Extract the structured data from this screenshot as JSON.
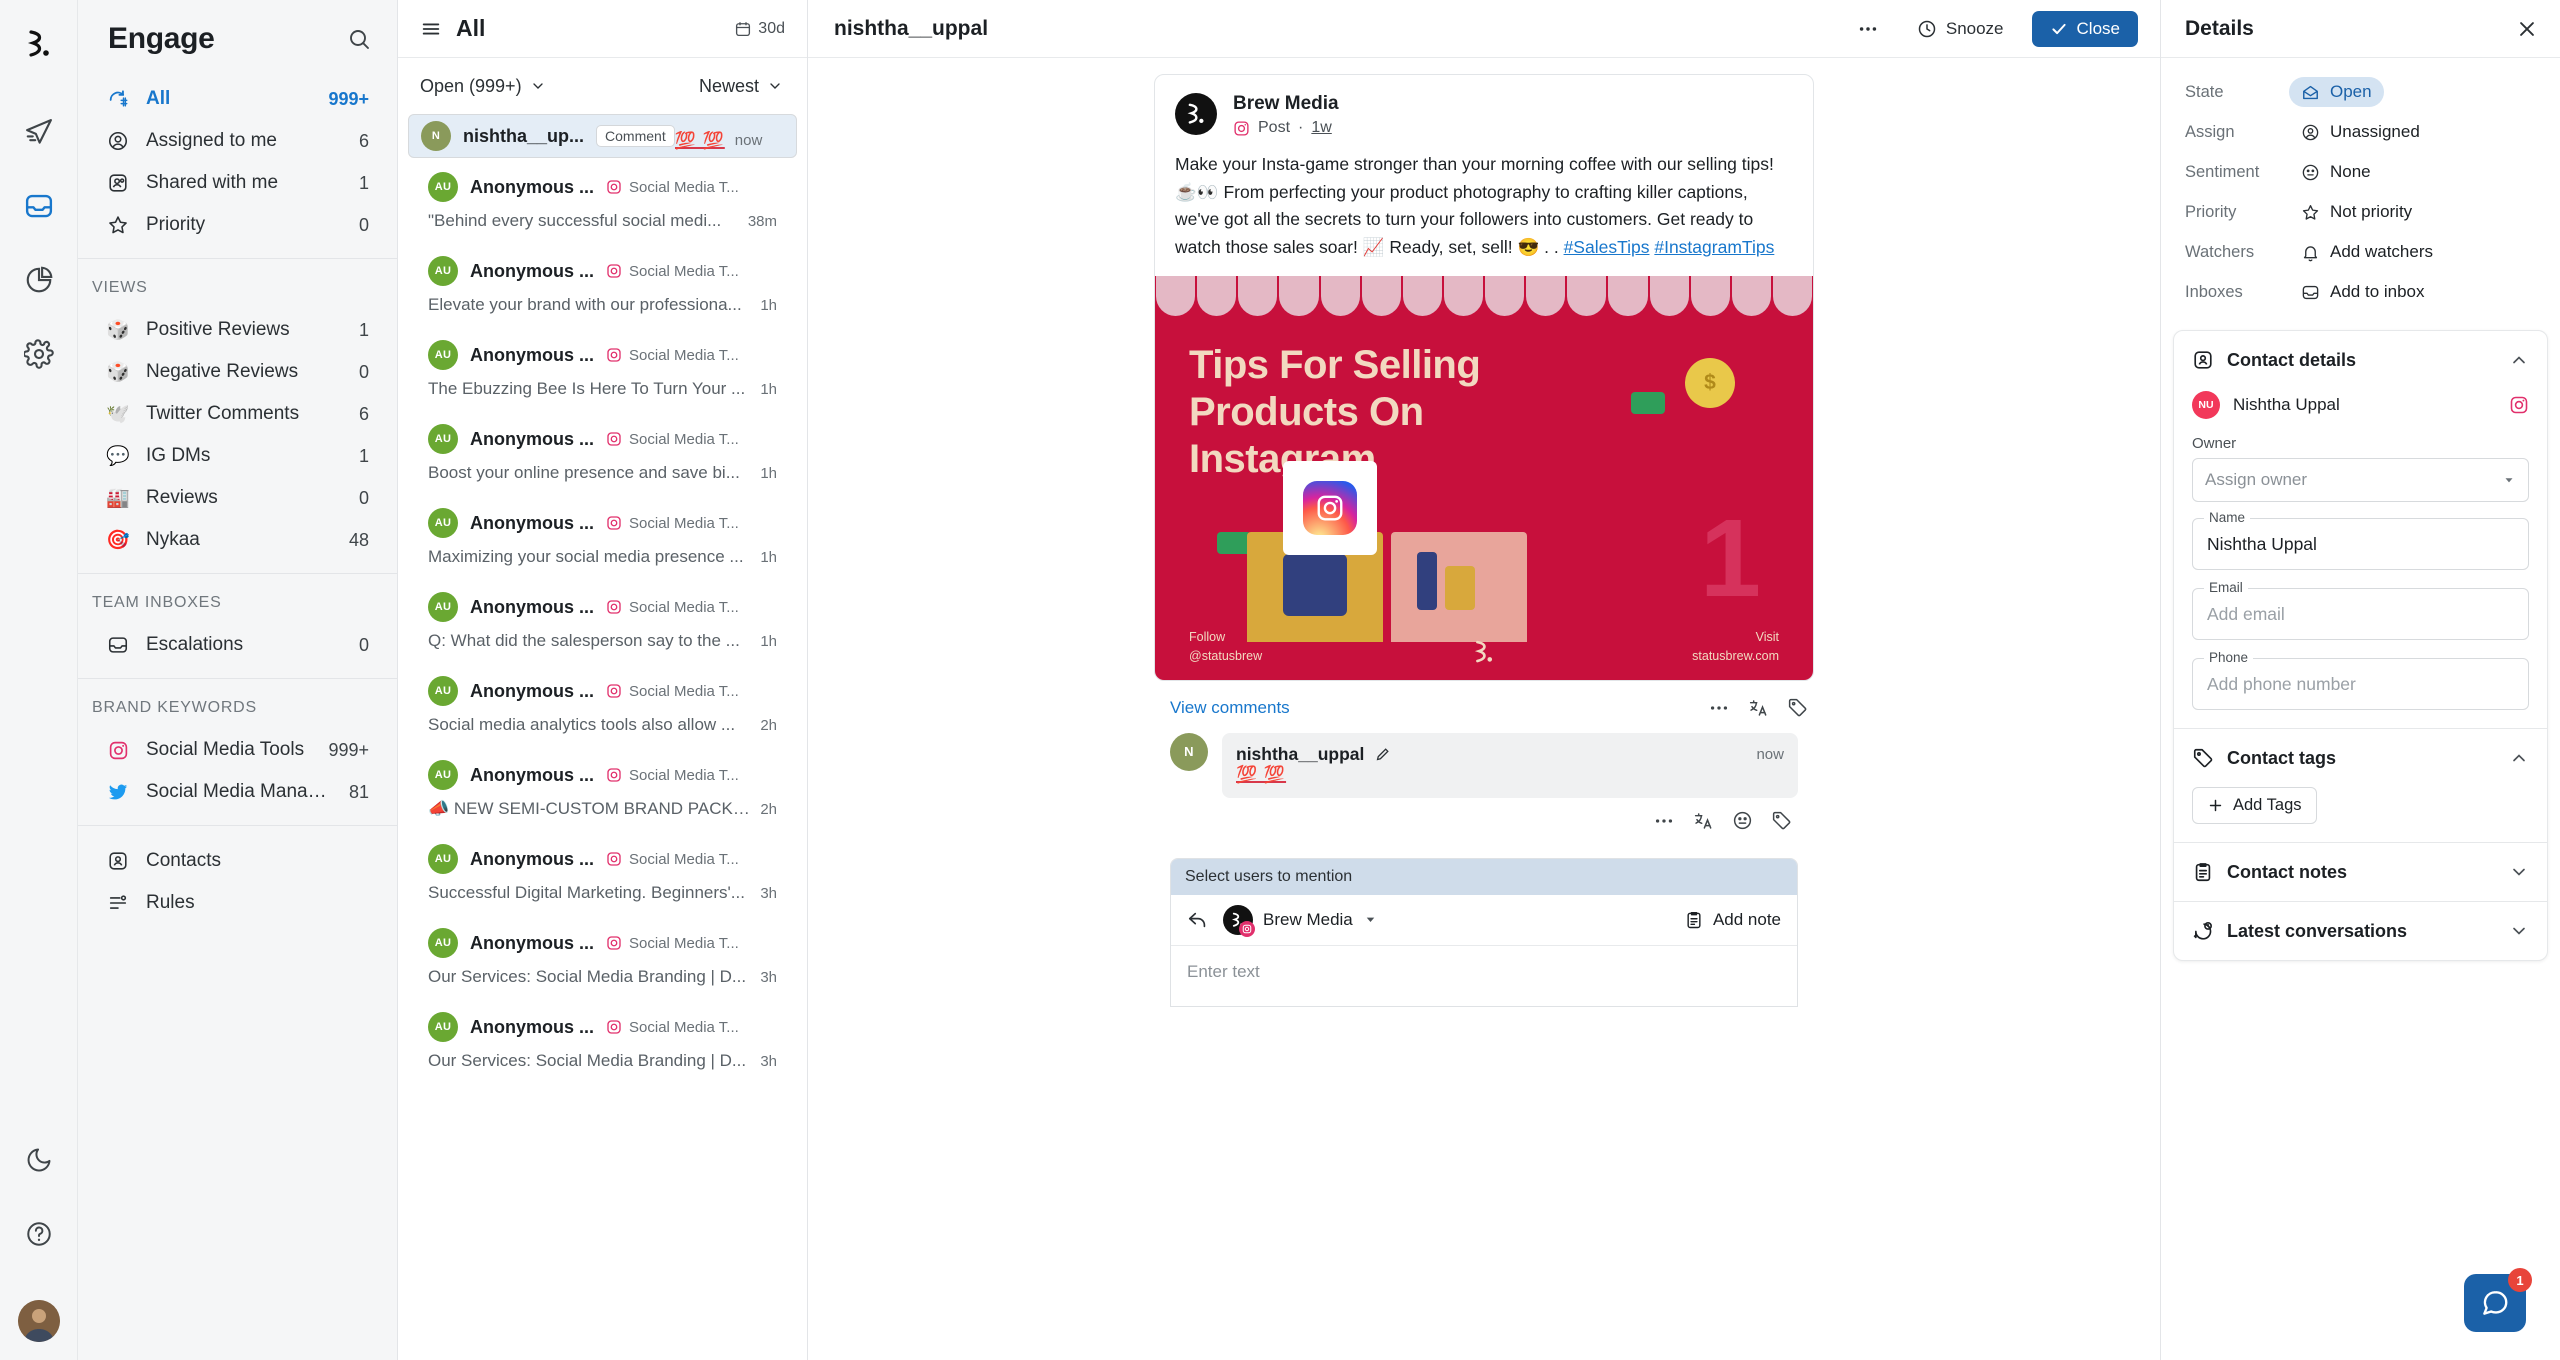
{
  "rail": {
    "logo": "statusbrew-logo",
    "icons": [
      {
        "name": "publish-icon",
        "glyph": "send"
      },
      {
        "name": "engage-icon",
        "glyph": "inbox",
        "active": true
      },
      {
        "name": "reports-icon",
        "glyph": "pie"
      },
      {
        "name": "settings-icon",
        "glyph": "gear"
      }
    ],
    "bottom": [
      {
        "name": "dark-mode-icon",
        "glyph": "moon"
      },
      {
        "name": "help-icon",
        "glyph": "question"
      }
    ]
  },
  "sidebar": {
    "title": "Engage",
    "search_icon": "search-icon",
    "primary": [
      {
        "label": "All",
        "count": "999+",
        "icon": "all-conversations-icon",
        "active": true
      },
      {
        "label": "Assigned to me",
        "count": "6",
        "icon": "assigned-icon"
      },
      {
        "label": "Shared with me",
        "count": "1",
        "icon": "shared-icon"
      },
      {
        "label": "Priority",
        "count": "0",
        "icon": "star-icon"
      }
    ],
    "views_caption": "VIEWS",
    "views": [
      {
        "label": "Positive Reviews",
        "count": "1",
        "emoji": "🎲"
      },
      {
        "label": "Negative Reviews",
        "count": "0",
        "emoji": "🎲"
      },
      {
        "label": "Twitter Comments",
        "count": "6",
        "emoji": "🕊"
      },
      {
        "label": "IG DMs",
        "count": "1",
        "emoji": "💬"
      },
      {
        "label": "Reviews",
        "count": "0",
        "emoji": "🏭"
      },
      {
        "label": "Nykaa",
        "count": "48",
        "emoji": "🎯"
      }
    ],
    "team_caption": "TEAM INBOXES",
    "team": [
      {
        "label": "Escalations",
        "count": "0",
        "icon": "inbox-icon"
      }
    ],
    "brand_caption": "BRAND KEYWORDS",
    "brand": [
      {
        "label": "Social Media Tools",
        "count": "999+",
        "icon": "instagram-icon"
      },
      {
        "label": "Social Media Management",
        "count": "81",
        "icon": "twitter-icon"
      }
    ],
    "footer": [
      {
        "label": "Contacts",
        "icon": "contacts-icon"
      },
      {
        "label": "Rules",
        "icon": "rules-icon"
      }
    ]
  },
  "conversations": {
    "header_title": "All",
    "range_label": "30d",
    "filter_state": "Open (999+)",
    "sort": "Newest",
    "items": [
      {
        "name": "nishtha__up...",
        "badge": "Comment",
        "source": "",
        "preview": "💯 💯",
        "time": "now",
        "avatar": "N",
        "avatar_color": "#8a9a5b",
        "selected": true,
        "preview_is_emoji": true
      },
      {
        "name": "Anonymous ...",
        "source": "Social Media T...",
        "preview": "\"Behind every successful social medi...",
        "time": "38m",
        "avatar": "AU",
        "avatar_color": "#6aa832"
      },
      {
        "name": "Anonymous ...",
        "source": "Social Media T...",
        "preview": "Elevate your brand with our professiona...",
        "time": "1h",
        "avatar": "AU",
        "avatar_color": "#6aa832"
      },
      {
        "name": "Anonymous ...",
        "source": "Social Media T...",
        "preview": "The Ebuzzing Bee Is Here To Turn Your ...",
        "time": "1h",
        "avatar": "AU",
        "avatar_color": "#6aa832"
      },
      {
        "name": "Anonymous ...",
        "source": "Social Media T...",
        "preview": "Boost your online presence and save bi...",
        "time": "1h",
        "avatar": "AU",
        "avatar_color": "#6aa832"
      },
      {
        "name": "Anonymous ...",
        "source": "Social Media T...",
        "preview": "Maximizing your social media presence ...",
        "time": "1h",
        "avatar": "AU",
        "avatar_color": "#6aa832"
      },
      {
        "name": "Anonymous ...",
        "source": "Social Media T...",
        "preview": "Q: What did the salesperson say to the ...",
        "time": "1h",
        "avatar": "AU",
        "avatar_color": "#6aa832"
      },
      {
        "name": "Anonymous ...",
        "source": "Social Media T...",
        "preview": "Social media analytics tools also allow ...",
        "time": "2h",
        "avatar": "AU",
        "avatar_color": "#6aa832"
      },
      {
        "name": "Anonymous ...",
        "source": "Social Media T...",
        "preview": "📣 NEW SEMI-CUSTOM BRAND PACKA...",
        "time": "2h",
        "avatar": "AU",
        "avatar_color": "#6aa832"
      },
      {
        "name": "Anonymous ...",
        "source": "Social Media T...",
        "preview": "Successful Digital Marketing. Beginners'...",
        "time": "3h",
        "avatar": "AU",
        "avatar_color": "#6aa832"
      },
      {
        "name": "Anonymous ...",
        "source": "Social Media T...",
        "preview": "Our Services: Social Media Branding | D...",
        "time": "3h",
        "avatar": "AU",
        "avatar_color": "#6aa832"
      },
      {
        "name": "Anonymous ...",
        "source": "Social Media T...",
        "preview": "Our Services: Social Media Branding | D...",
        "time": "3h",
        "avatar": "AU",
        "avatar_color": "#6aa832"
      }
    ]
  },
  "center": {
    "title": "nishtha__uppal",
    "more_icon": "more-options-icon",
    "snooze_label": "Snooze",
    "close_label": "Close",
    "post": {
      "author": "Brew Media",
      "type": "Post",
      "age": "1w",
      "text": "Make your Insta-game stronger than your morning coffee with our selling tips! ☕👀 From perfecting your product photography to crafting killer captions, we've got all the secrets to turn your followers into customers. Get ready to watch those sales soar! 📈 Ready, set, sell! 😎 . .",
      "hashtags": [
        "#SalesTips",
        "#InstagramTips"
      ],
      "creative": {
        "title_line1": "Tips For Selling",
        "title_line2": "Products On",
        "title_line3": "Instagram",
        "number": "1",
        "follow_label": "Follow",
        "follow_handle": "@statusbrew",
        "visit_label": "Visit",
        "visit_url": "statusbrew.com"
      }
    },
    "view_comments": "View comments",
    "comment": {
      "author": "nishtha__uppal",
      "text": "💯 💯",
      "time": "now"
    },
    "reply": {
      "mention_hint": "Select users to mention",
      "account": "Brew Media",
      "add_note": "Add note",
      "placeholder": "Enter text"
    }
  },
  "details": {
    "title": "Details",
    "close_icon": "close-icon",
    "fields": [
      {
        "label": "State",
        "value": "Open",
        "icon": "open-envelope-icon",
        "highlight": true
      },
      {
        "label": "Assign",
        "value": "Unassigned",
        "icon": "user-circle-icon"
      },
      {
        "label": "Sentiment",
        "value": "None",
        "icon": "neutral-face-icon"
      },
      {
        "label": "Priority",
        "value": "Not priority",
        "icon": "star-icon"
      },
      {
        "label": "Watchers",
        "value": "Add watchers",
        "icon": "bell-icon"
      },
      {
        "label": "Inboxes",
        "value": "Add to inbox",
        "icon": "inbox-icon"
      }
    ],
    "contact_details": {
      "section_title": "Contact details",
      "contact_initials": "NU",
      "contact_name": "Nishtha Uppal",
      "channel_icon": "instagram-icon",
      "owner_label": "Owner",
      "owner_placeholder": "Assign owner",
      "name_label": "Name",
      "name_value": "Nishtha Uppal",
      "email_label": "Email",
      "email_placeholder": "Add email",
      "phone_label": "Phone",
      "phone_placeholder": "Add phone number"
    },
    "contact_tags": {
      "section_title": "Contact tags",
      "add_label": "Add Tags"
    },
    "contact_notes": {
      "section_title": "Contact notes"
    },
    "latest_conversations": {
      "section_title": "Latest conversations"
    }
  },
  "chat_widget": {
    "badge": "1",
    "icon": "chat-icon"
  },
  "colors": {
    "accent": "#1877cc",
    "primary_button": "#1b61a8",
    "selected_row": "#e4edf6",
    "instagram": "#e1306c",
    "twitter": "#1d9bf0",
    "creative_bg": "#c7103c"
  }
}
